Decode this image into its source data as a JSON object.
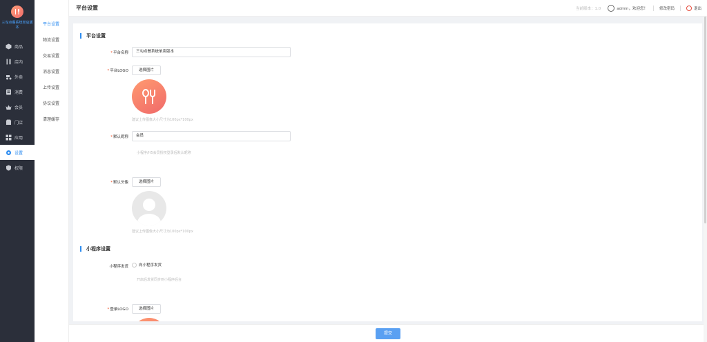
{
  "sidebar": {
    "logo_text": "三勾点餐系统单店版本",
    "items": [
      {
        "label": "商品",
        "icon": "goods-icon"
      },
      {
        "label": "店内",
        "icon": "dine-in-icon"
      },
      {
        "label": "外卖",
        "icon": "delivery-icon"
      },
      {
        "label": "消费",
        "icon": "consume-icon"
      },
      {
        "label": "会员",
        "icon": "member-icon"
      },
      {
        "label": "门店",
        "icon": "store-icon"
      },
      {
        "label": "应用",
        "icon": "apps-icon"
      },
      {
        "label": "设置",
        "icon": "settings-icon"
      },
      {
        "label": "权限",
        "icon": "permission-icon"
      }
    ],
    "active_index": 7
  },
  "submenu": {
    "items": [
      "平台设置",
      "物流设置",
      "交易设置",
      "消息设置",
      "上传设置",
      "协议设置",
      "清理缓存"
    ],
    "active_index": 0
  },
  "header": {
    "title": "平台设置",
    "version": "当前版本：1.0",
    "user": "admin，欢迎您！",
    "change_password": "修改密码",
    "logout": "退出"
  },
  "form": {
    "platform_section": "平台设置",
    "platform_name_label": "平台名称",
    "platform_name_value": "三勾点餐系统单店版本",
    "platform_logo_label": "平台LOGO",
    "pick_image": "选择图片",
    "logo_hint": "建议上传图像大小尺寸为100px*100px",
    "default_nickname_label": "默认昵称",
    "default_nickname_value": "会员",
    "nickname_hint": "小程序/H5会员授权登录后默认昵称",
    "default_avatar_label": "默认头像",
    "avatar_hint": "建议上传图像大小尺寸为100px*100px",
    "mini_section": "小程序设置",
    "mini_shipping_label": "小程序发货",
    "mini_shipping_option": "向小程序发货",
    "mini_shipping_hint": "开启后发货同步到小程序后台",
    "login_logo_label": "登录LOGO"
  },
  "footer": {
    "submit": "提交"
  }
}
